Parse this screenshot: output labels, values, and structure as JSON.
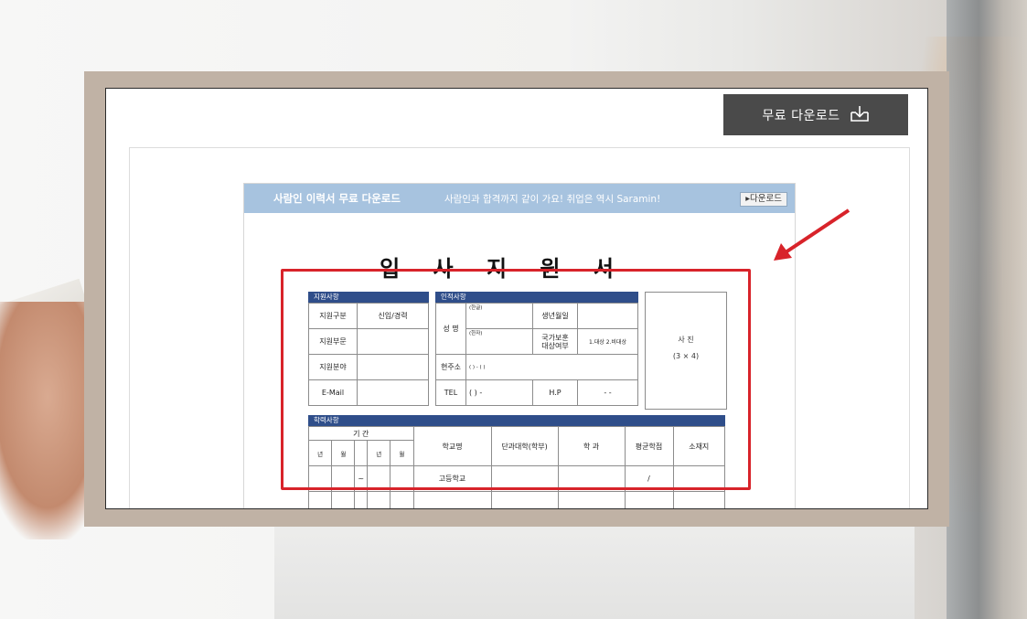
{
  "download_button": {
    "label": "무료 다운로드",
    "icon": "download-tray-icon"
  },
  "doc_banner": {
    "title": "사람인 이력서 무료 다운로드",
    "tagline": "사람인과 합격까지 같이 가요! 취업은 역시 Saramin!",
    "button": "▸다운로드"
  },
  "form": {
    "title": "입 사 지 원 서",
    "apply_section": {
      "header": "지원사항",
      "rows": [
        {
          "label": "지원구분",
          "value": "신입/경력"
        },
        {
          "label": "지원부문",
          "value": ""
        },
        {
          "label": "지원분야",
          "value": ""
        },
        {
          "label": "E-Mail",
          "value": ""
        }
      ]
    },
    "personal_section": {
      "header": "인적사항",
      "name_label": "성 명",
      "hangul": "(한글)",
      "hanja": "(한자)",
      "birth_label": "생년월일",
      "veteran_label": "국가보훈\n대상여부",
      "veteran_value": "1.대상 2.비대상",
      "address_label": "현주소",
      "address_value": "(    ) - (    )",
      "tel_label": "TEL",
      "tel_value": "(   )    -",
      "hp_label": "H.P",
      "hp_value": "-     -"
    },
    "photo": {
      "label": "사  진",
      "size": "(3 × 4)"
    },
    "education_section": {
      "header": "학력사항",
      "period_label": "기 간",
      "year": "년",
      "month": "월",
      "columns": [
        "학교명",
        "단과대학(학부)",
        "학 과",
        "평균학점",
        "소재지"
      ],
      "first_row": {
        "dash": "~",
        "school": "고등학교",
        "gpa": "/"
      }
    }
  },
  "colors": {
    "frame": "#c0b2a5",
    "button_bg": "#4a4a4a",
    "banner": "#a7c3df",
    "section_head": "#2f4e8a",
    "highlight": "#d8232a"
  }
}
